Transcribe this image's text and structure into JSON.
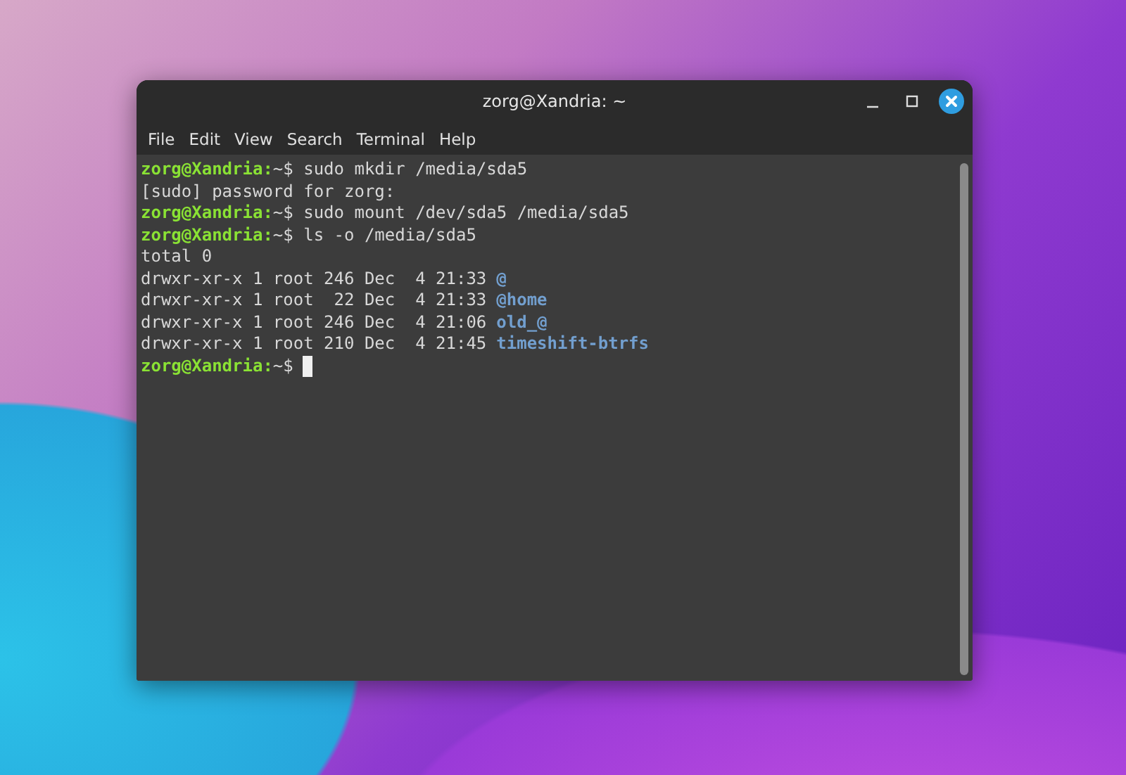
{
  "window": {
    "title": "zorg@Xandria: ~"
  },
  "menu": [
    "File",
    "Edit",
    "View",
    "Search",
    "Terminal",
    "Help"
  ],
  "terminal": {
    "lines": [
      [
        {
          "kind": "prompt",
          "text": "zorg@Xandria:"
        },
        {
          "kind": "plain",
          "text": "~$ sudo mkdir /media/sda5"
        }
      ],
      [
        {
          "kind": "plain",
          "text": "[sudo] password for zorg:"
        }
      ],
      [
        {
          "kind": "prompt",
          "text": "zorg@Xandria:"
        },
        {
          "kind": "plain",
          "text": "~$ sudo mount /dev/sda5 /media/sda5"
        }
      ],
      [
        {
          "kind": "prompt",
          "text": "zorg@Xandria:"
        },
        {
          "kind": "plain",
          "text": "~$ ls -o /media/sda5"
        }
      ],
      [
        {
          "kind": "plain",
          "text": "total 0"
        }
      ],
      [
        {
          "kind": "plain",
          "text": "drwxr-xr-x 1 root 246 Dec  4 21:33"
        },
        {
          "kind": "dir",
          "text": "@"
        }
      ],
      [
        {
          "kind": "plain",
          "text": "drwxr-xr-x 1 root  22 Dec  4 21:33"
        },
        {
          "kind": "dir",
          "text": "@home"
        }
      ],
      [
        {
          "kind": "plain",
          "text": "drwxr-xr-x 1 root 246 Dec  4 21:06"
        },
        {
          "kind": "dir",
          "text": "old_@"
        }
      ],
      [
        {
          "kind": "plain",
          "text": "drwxr-xr-x 1 root 210 Dec  4 21:45"
        },
        {
          "kind": "dir",
          "text": "timeshift-btrfs"
        }
      ],
      [
        {
          "kind": "prompt",
          "text": "zorg@Xandria:"
        },
        {
          "kind": "plain",
          "text": "~$"
        }
      ]
    ],
    "cursor": true
  }
}
